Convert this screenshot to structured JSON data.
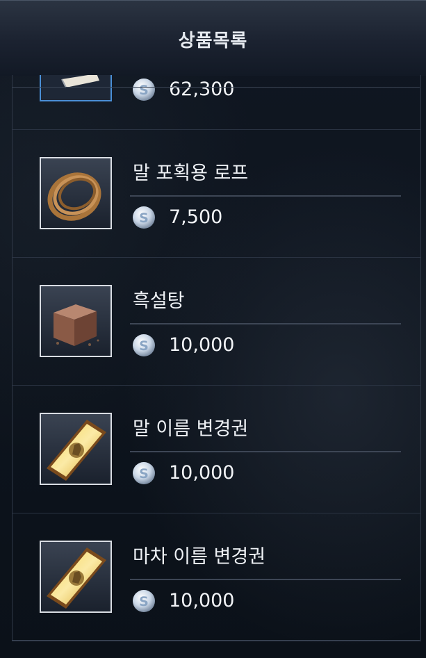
{
  "window": {
    "title": "상품목록"
  },
  "currency": {
    "icon": "silver-coin-icon",
    "symbol": "S"
  },
  "items": [
    {
      "name": "",
      "price": "62,300",
      "icon": "scroll-item-icon",
      "selected": true
    },
    {
      "name": "말 포획용 로프",
      "price": "7,500",
      "icon": "rope-icon",
      "selected": false
    },
    {
      "name": "흑설탕",
      "price": "10,000",
      "icon": "brown-sugar-cube-icon",
      "selected": false
    },
    {
      "name": "말 이름 변경권",
      "price": "10,000",
      "icon": "horse-name-ticket-icon",
      "selected": false
    },
    {
      "name": "마차 이름 변경권",
      "price": "10,000",
      "icon": "wagon-name-ticket-icon",
      "selected": false
    }
  ],
  "colors": {
    "background": "#0b1018",
    "header": "#1b2230",
    "selected_border": "#4a8fd6",
    "frame_border": "#d9dde3"
  }
}
